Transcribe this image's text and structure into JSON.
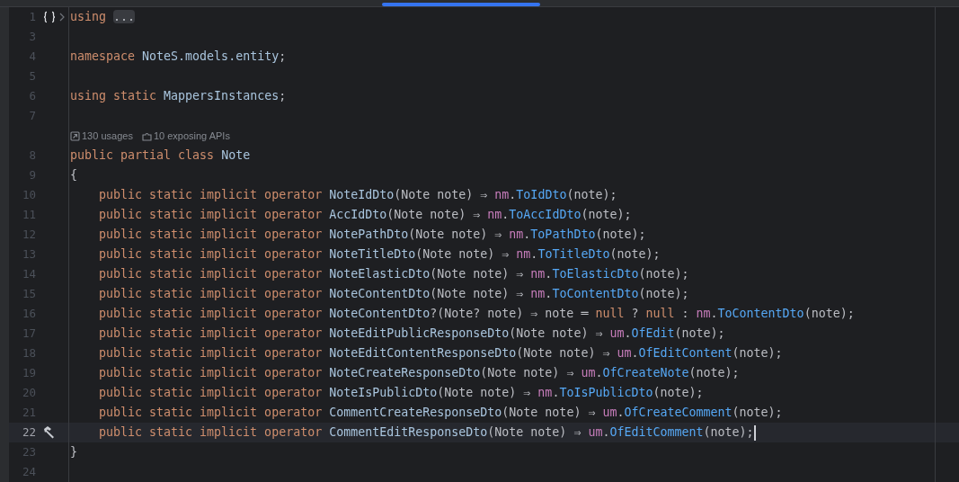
{
  "editor": {
    "hints": [
      {
        "kind": "usages",
        "text": "130 usages"
      },
      {
        "kind": "apis",
        "text": "10 exposing APIs"
      }
    ],
    "lines": [
      {
        "number": "1",
        "gutter": {
          "kind": "braces"
        },
        "folded": true,
        "current": false,
        "indented": false,
        "tokens": [
          {
            "text": "using ",
            "kind": "kw"
          },
          {
            "text": "...",
            "kind": "fold"
          }
        ]
      },
      {
        "number": "3",
        "current": false
      },
      {
        "number": "4",
        "current": false,
        "indented": false,
        "tokens": [
          {
            "text": "namespace ",
            "kind": "kw"
          },
          {
            "text": "NoteS.models.entity",
            "kind": "type"
          },
          {
            "text": ";",
            "kind": "plain"
          }
        ]
      },
      {
        "number": "5",
        "current": false
      },
      {
        "number": "6",
        "current": false,
        "indented": false,
        "tokens": [
          {
            "text": "using static ",
            "kind": "kw"
          },
          {
            "text": "MappersInstances",
            "kind": "type"
          },
          {
            "text": ";",
            "kind": "plain"
          }
        ]
      },
      {
        "number": "7",
        "current": false,
        "hints_after": true
      },
      {
        "number": "8",
        "current": false,
        "indented": false,
        "tokens": [
          {
            "text": "public partial class ",
            "kind": "kw"
          },
          {
            "text": "Note",
            "kind": "type"
          }
        ]
      },
      {
        "number": "9",
        "current": false,
        "indented": false,
        "tokens": [
          {
            "text": "{",
            "kind": "plain"
          }
        ]
      },
      {
        "number": "10",
        "current": false,
        "indented": true,
        "tokens": [
          {
            "text": "public static implicit operator ",
            "kind": "kw"
          },
          {
            "text": "NoteIdDto",
            "kind": "type"
          },
          {
            "text": "(Note note) ⇒ ",
            "kind": "plain"
          },
          {
            "text": "nm",
            "kind": "field"
          },
          {
            "text": ".",
            "kind": "plain"
          },
          {
            "text": "ToIdDto",
            "kind": "method"
          },
          {
            "text": "(note);",
            "kind": "plain"
          }
        ]
      },
      {
        "number": "11",
        "current": false,
        "indented": true,
        "tokens": [
          {
            "text": "public static implicit operator ",
            "kind": "kw"
          },
          {
            "text": "AccIdDto",
            "kind": "type"
          },
          {
            "text": "(Note note) ⇒ ",
            "kind": "plain"
          },
          {
            "text": "nm",
            "kind": "field"
          },
          {
            "text": ".",
            "kind": "plain"
          },
          {
            "text": "ToAccIdDto",
            "kind": "method"
          },
          {
            "text": "(note);",
            "kind": "plain"
          }
        ]
      },
      {
        "number": "12",
        "current": false,
        "indented": true,
        "tokens": [
          {
            "text": "public static implicit operator ",
            "kind": "kw"
          },
          {
            "text": "NotePathDto",
            "kind": "type"
          },
          {
            "text": "(Note note) ⇒ ",
            "kind": "plain"
          },
          {
            "text": "nm",
            "kind": "field"
          },
          {
            "text": ".",
            "kind": "plain"
          },
          {
            "text": "ToPathDto",
            "kind": "method"
          },
          {
            "text": "(note);",
            "kind": "plain"
          }
        ]
      },
      {
        "number": "13",
        "current": false,
        "indented": true,
        "tokens": [
          {
            "text": "public static implicit operator ",
            "kind": "kw"
          },
          {
            "text": "NoteTitleDto",
            "kind": "type"
          },
          {
            "text": "(Note note) ⇒ ",
            "kind": "plain"
          },
          {
            "text": "nm",
            "kind": "field"
          },
          {
            "text": ".",
            "kind": "plain"
          },
          {
            "text": "ToTitleDto",
            "kind": "method"
          },
          {
            "text": "(note);",
            "kind": "plain"
          }
        ]
      },
      {
        "number": "14",
        "current": false,
        "indented": true,
        "tokens": [
          {
            "text": "public static implicit operator ",
            "kind": "kw"
          },
          {
            "text": "NoteElasticDto",
            "kind": "type"
          },
          {
            "text": "(Note note) ⇒ ",
            "kind": "plain"
          },
          {
            "text": "nm",
            "kind": "field"
          },
          {
            "text": ".",
            "kind": "plain"
          },
          {
            "text": "ToElasticDto",
            "kind": "method"
          },
          {
            "text": "(note);",
            "kind": "plain"
          }
        ]
      },
      {
        "number": "15",
        "current": false,
        "indented": true,
        "tokens": [
          {
            "text": "public static implicit operator ",
            "kind": "kw"
          },
          {
            "text": "NoteContentDto",
            "kind": "type"
          },
          {
            "text": "(Note note) ⇒ ",
            "kind": "plain"
          },
          {
            "text": "nm",
            "kind": "field"
          },
          {
            "text": ".",
            "kind": "plain"
          },
          {
            "text": "ToContentDto",
            "kind": "method"
          },
          {
            "text": "(note);",
            "kind": "plain"
          }
        ]
      },
      {
        "number": "16",
        "current": false,
        "indented": true,
        "tokens": [
          {
            "text": "public static implicit operator ",
            "kind": "kw"
          },
          {
            "text": "NoteContentDto",
            "kind": "type"
          },
          {
            "text": "?(Note? note) ⇒ note ═ ",
            "kind": "plain"
          },
          {
            "text": "null",
            "kind": "kw"
          },
          {
            "text": " ? ",
            "kind": "plain"
          },
          {
            "text": "null",
            "kind": "kw"
          },
          {
            "text": " : ",
            "kind": "plain"
          },
          {
            "text": "nm",
            "kind": "field"
          },
          {
            "text": ".",
            "kind": "plain"
          },
          {
            "text": "ToContentDto",
            "kind": "method"
          },
          {
            "text": "(note);",
            "kind": "plain"
          }
        ]
      },
      {
        "number": "17",
        "current": false,
        "indented": true,
        "tokens": [
          {
            "text": "public static implicit operator ",
            "kind": "kw"
          },
          {
            "text": "NoteEditPublicResponseDto",
            "kind": "type"
          },
          {
            "text": "(Note note) ⇒ ",
            "kind": "plain"
          },
          {
            "text": "um",
            "kind": "field"
          },
          {
            "text": ".",
            "kind": "plain"
          },
          {
            "text": "OfEdit",
            "kind": "method"
          },
          {
            "text": "(note);",
            "kind": "plain"
          }
        ]
      },
      {
        "number": "18",
        "current": false,
        "indented": true,
        "tokens": [
          {
            "text": "public static implicit operator ",
            "kind": "kw"
          },
          {
            "text": "NoteEditContentResponseDto",
            "kind": "type"
          },
          {
            "text": "(Note note) ⇒ ",
            "kind": "plain"
          },
          {
            "text": "um",
            "kind": "field"
          },
          {
            "text": ".",
            "kind": "plain"
          },
          {
            "text": "OfEditContent",
            "kind": "method"
          },
          {
            "text": "(note);",
            "kind": "plain"
          }
        ]
      },
      {
        "number": "19",
        "current": false,
        "indented": true,
        "tokens": [
          {
            "text": "public static implicit operator ",
            "kind": "kw"
          },
          {
            "text": "NoteCreateResponseDto",
            "kind": "type"
          },
          {
            "text": "(Note note) ⇒ ",
            "kind": "plain"
          },
          {
            "text": "um",
            "kind": "field"
          },
          {
            "text": ".",
            "kind": "plain"
          },
          {
            "text": "OfCreateNote",
            "kind": "method"
          },
          {
            "text": "(note);",
            "kind": "plain"
          }
        ]
      },
      {
        "number": "20",
        "current": false,
        "indented": true,
        "tokens": [
          {
            "text": "public static implicit operator ",
            "kind": "kw"
          },
          {
            "text": "NoteIsPublicDto",
            "kind": "type"
          },
          {
            "text": "(Note note) ⇒ ",
            "kind": "plain"
          },
          {
            "text": "nm",
            "kind": "field"
          },
          {
            "text": ".",
            "kind": "plain"
          },
          {
            "text": "ToIsPublicDto",
            "kind": "method"
          },
          {
            "text": "(note);",
            "kind": "plain"
          }
        ]
      },
      {
        "number": "21",
        "current": false,
        "indented": true,
        "tokens": [
          {
            "text": "public static implicit operator ",
            "kind": "kw"
          },
          {
            "text": "CommentCreateResponseDto",
            "kind": "type"
          },
          {
            "text": "(Note note) ⇒ ",
            "kind": "plain"
          },
          {
            "text": "um",
            "kind": "field"
          },
          {
            "text": ".",
            "kind": "plain"
          },
          {
            "text": "OfCreateComment",
            "kind": "method"
          },
          {
            "text": "(note);",
            "kind": "plain"
          }
        ]
      },
      {
        "number": "22",
        "gutter": {
          "kind": "hammer"
        },
        "current": true,
        "indented": true,
        "tokens": [
          {
            "text": "public static implicit operator ",
            "kind": "kw"
          },
          {
            "text": "CommentEditResponseDto",
            "kind": "type"
          },
          {
            "text": "(Note note) ⇒ ",
            "kind": "plain"
          },
          {
            "text": "um",
            "kind": "field"
          },
          {
            "text": ".",
            "kind": "plain"
          },
          {
            "text": "OfEditComment",
            "kind": "method"
          },
          {
            "text": "(note);",
            "kind": "plain"
          }
        ]
      },
      {
        "number": "23",
        "current": false,
        "indented": false,
        "tokens": [
          {
            "text": "}",
            "kind": "plain"
          }
        ]
      },
      {
        "number": "24",
        "current": false
      }
    ]
  }
}
